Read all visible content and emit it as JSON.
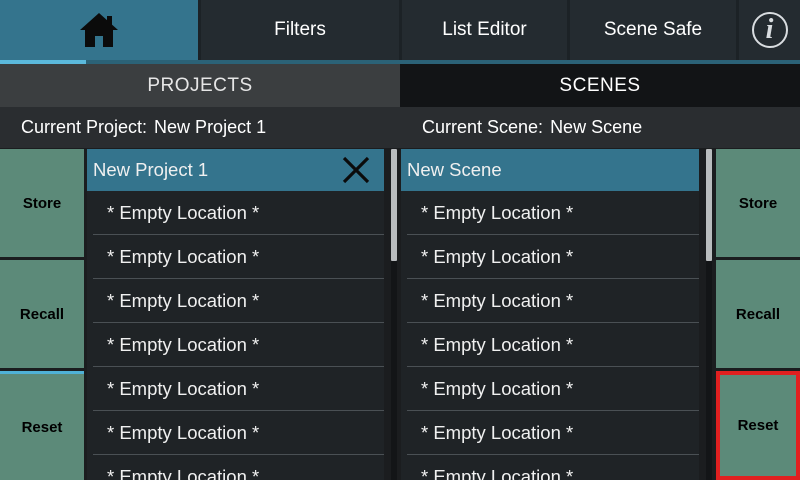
{
  "tabs": {
    "home_icon": "home-icon",
    "filters": "Filters",
    "list_editor": "List Editor",
    "scene_safe": "Scene Safe",
    "info_icon": "info-icon",
    "info_glyph": "i"
  },
  "sections": {
    "projects": "PROJECTS",
    "scenes": "SCENES"
  },
  "current": {
    "project_label": "Current Project:",
    "project_value": "New Project 1",
    "scene_label": "Current Scene:",
    "scene_value": "New Scene"
  },
  "left_buttons": {
    "store": "Store",
    "recall": "Recall",
    "reset": "Reset"
  },
  "right_buttons": {
    "store": "Store",
    "recall": "Recall",
    "reset": "Reset"
  },
  "projects_list": [
    "New Project 1",
    "* Empty Location *",
    "* Empty Location *",
    "* Empty Location *",
    "* Empty Location *",
    "* Empty Location *",
    "* Empty Location *",
    "* Empty Location *"
  ],
  "scenes_list": [
    "New Scene",
    "* Empty Location *",
    "* Empty Location *",
    "* Empty Location *",
    "* Empty Location *",
    "* Empty Location *",
    "* Empty Location *",
    "* Empty Location *"
  ],
  "colors": {
    "accent": "#34748d",
    "button_green": "#5c8a79",
    "selection_outline": "#e02020"
  }
}
